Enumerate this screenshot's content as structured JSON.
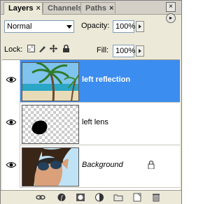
{
  "tabs": [
    {
      "label": "Layers",
      "active": true
    },
    {
      "label": "Channels",
      "active": false
    },
    {
      "label": "Paths",
      "active": false
    }
  ],
  "blend_mode": "Normal",
  "opacity": {
    "label": "Opacity:",
    "value": "100%"
  },
  "lock_label": "Lock:",
  "fill": {
    "label": "Fill:",
    "value": "100%"
  },
  "layers": [
    {
      "name": "left reflection",
      "selected": true,
      "visible": true
    },
    {
      "name": "left lens",
      "selected": false,
      "visible": true
    },
    {
      "name": "Background",
      "selected": false,
      "visible": true,
      "locked": true
    }
  ],
  "bottom_icons": [
    "link-layers-icon",
    "layer-style-icon",
    "add-mask-icon",
    "adjustment-layer-icon",
    "new-group-icon",
    "new-layer-icon",
    "delete-layer-icon"
  ],
  "colors": {
    "selection": "#3c8df0",
    "panel": "#ece9d8"
  }
}
